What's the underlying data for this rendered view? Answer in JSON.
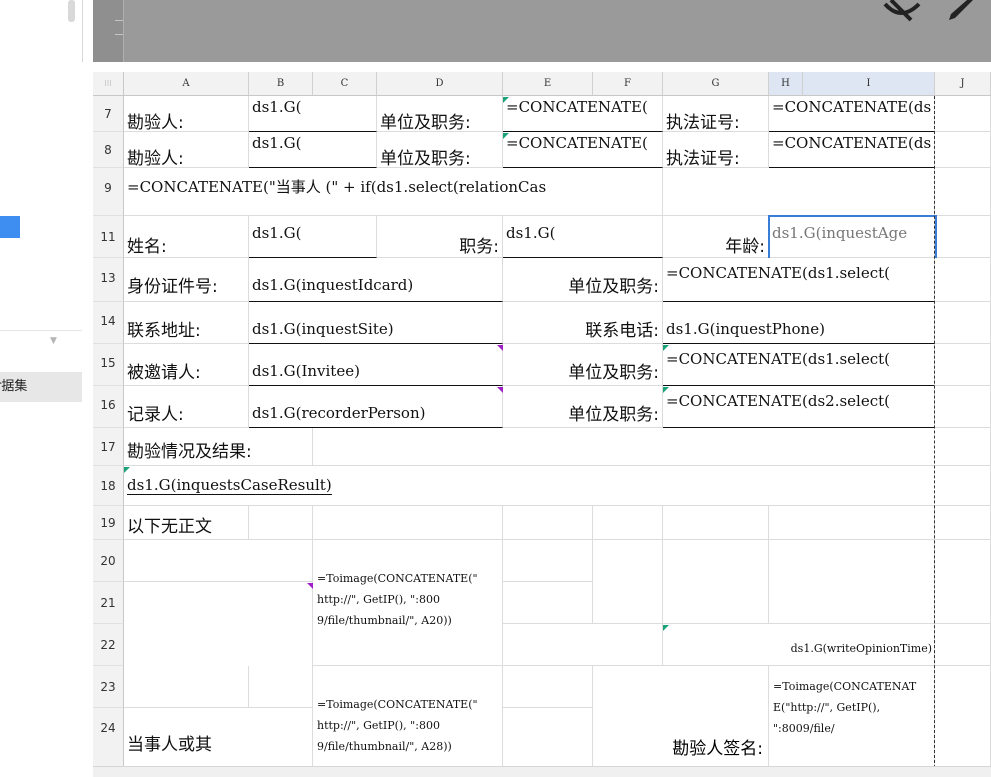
{
  "sidebar": {
    "dataset_label": "r据集"
  },
  "icons": [
    "eye-slash-icon",
    "pencil-icon"
  ],
  "columns": [
    "A",
    "B",
    "C",
    "D",
    "E",
    "F",
    "G",
    "H",
    "I",
    "J"
  ],
  "rows": {
    "r7": {
      "num": "7",
      "a": "勘验人:",
      "b": "ds1.G(",
      "d": "单位及职务:",
      "e": "=CONCATENATE(",
      "g": "执法证号:",
      "h": "=CONCATENATE(ds"
    },
    "r8": {
      "num": "8",
      "a": "勘验人:",
      "b": "ds1.G(",
      "d": "单位及职务:",
      "e": "=CONCATENATE(",
      "g": "执法证号:",
      "h": "=CONCATENATE(ds"
    },
    "r9": {
      "num": "9",
      "a": "=CONCATENATE(\"当事人 (\" + if(ds1.select(relationCas"
    },
    "r11": {
      "num": "11",
      "a": "姓名:",
      "b": "ds1.G(",
      "d": "职务:",
      "e": "ds1.G(",
      "g": "年龄:",
      "h": "ds1.G(inquestAge"
    },
    "r13": {
      "num": "13",
      "a": "身份证件号:",
      "b": "ds1.G(inquestIdcard)",
      "e": "单位及职务:",
      "g": "=CONCATENATE(ds1.select("
    },
    "r14": {
      "num": "14",
      "a": "联系地址:",
      "b": "ds1.G(inquestSite)",
      "e": "联系电话:",
      "g": "ds1.G(inquestPhone)"
    },
    "r15": {
      "num": "15",
      "a": "被邀请人:",
      "b": "ds1.G(Invitee)",
      "e": "单位及职务:",
      "g": "=CONCATENATE(ds1.select("
    },
    "r16": {
      "num": "16",
      "a": "记录人:",
      "b": "ds1.G(recorderPerson)",
      "e": "单位及职务:",
      "g": "=CONCATENATE(ds2.select("
    },
    "r17": {
      "num": "17",
      "a": "勘验情况及结果:"
    },
    "r18": {
      "num": "18",
      "a": "ds1.G(inquestsCaseResult)"
    },
    "r19": {
      "num": "19",
      "a": "以下无正文"
    },
    "r20": {
      "num": "20"
    },
    "r21": {
      "num": "21",
      "c": "=Toimage(CONCATENATE(\" http://\", GetIP(), \":800 9/file/thumbnail/\", A20))"
    },
    "r22": {
      "num": "22",
      "g": "ds1.G(writeOpinionTime)"
    },
    "r23": {
      "num": "23"
    },
    "r24": {
      "num": "24",
      "a": "当事人或其",
      "c": "=Toimage(CONCATENATE(\" http://\", GetIP(), \":800 9/file/thumbnail/\", A28))",
      "f": "勘验人签名:",
      "h": "=Toimage(CONCATENAT E(\"http://\", GetIP(), \":8009/file/"
    }
  }
}
